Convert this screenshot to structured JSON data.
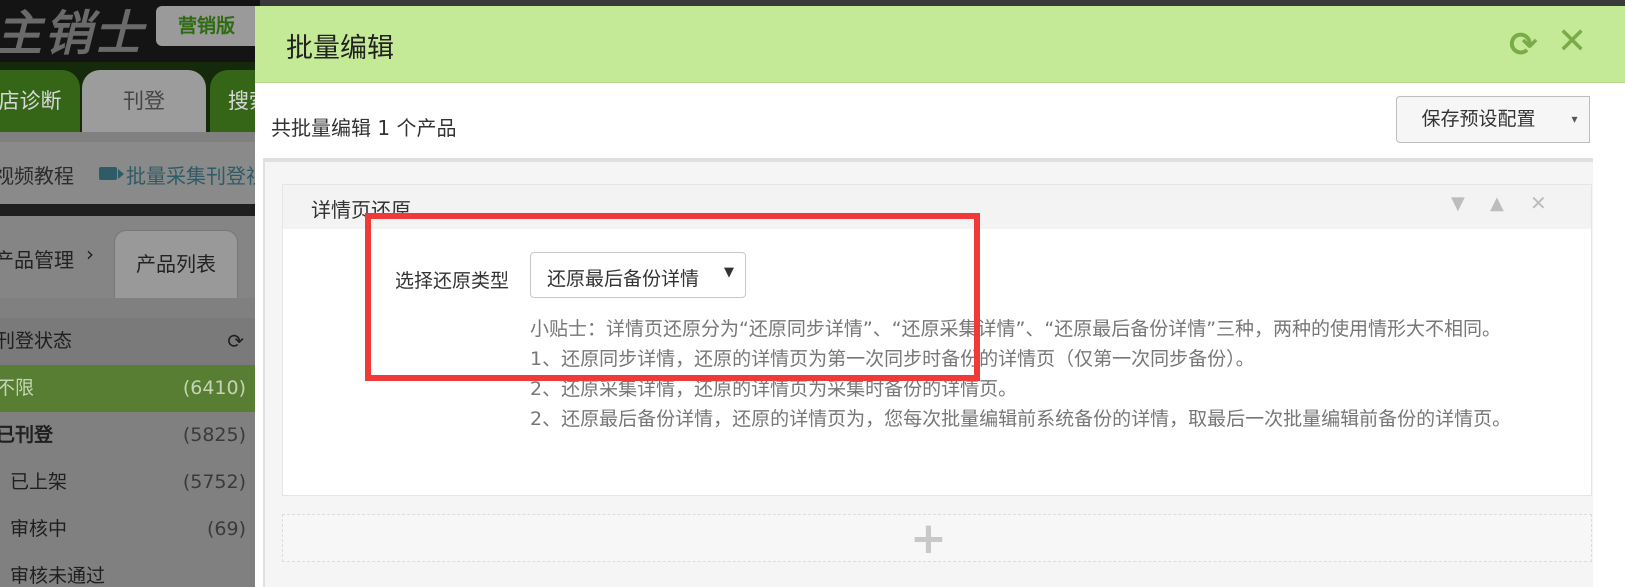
{
  "background": {
    "logo": "主销士",
    "edition": "营销版",
    "nav_tabs": [
      "店诊断",
      "刊登",
      "搜索"
    ],
    "links": {
      "video": "视频教程",
      "batch": "批量采集刊登视频"
    },
    "breadcrumb": {
      "parent": "产品管理",
      "current": "产品列表"
    },
    "filter": {
      "heading": "刊登状态",
      "rows": [
        {
          "label": "不限",
          "count": "(6410)"
        },
        {
          "label": "已刊登",
          "count": "(5825)"
        },
        {
          "label": "已上架",
          "count": "(5752)"
        },
        {
          "label": "审核中",
          "count": "(69)"
        },
        {
          "label": "审核未通过",
          "count": ""
        }
      ]
    }
  },
  "modal": {
    "title": "批量编辑",
    "count_text": "共批量编辑 1 个产品",
    "save_preset": "保存预设配置",
    "widget": {
      "title": "详情页还原",
      "field_label": "选择还原类型",
      "select_value": "还原最后备份详情",
      "tips": [
        "小贴士：详情页还原分为“还原同步详情”、“还原采集详情”、“还原最后备份详情”三种，两种的使用情形大不相同。",
        "1、还原同步详情，还原的详情页为第一次同步时备份的详情页（仅第一次同步备份）。",
        "2、还原采集详情，还原的详情页为采集时备份的详情页。",
        "2、还原最后备份详情，还原的详情页为，您每次批量编辑前系统备份的详情，取最后一次批量编辑前备份的详情页。"
      ]
    }
  },
  "colors": {
    "header_green": "#c5ea97",
    "highlight_red": "#f03a3a",
    "icon_green": "#7aaa4a"
  },
  "icons": [
    "refresh-icon",
    "close-icon",
    "chevron-down-icon",
    "chevron-up-icon",
    "plus-icon",
    "video-icon"
  ]
}
